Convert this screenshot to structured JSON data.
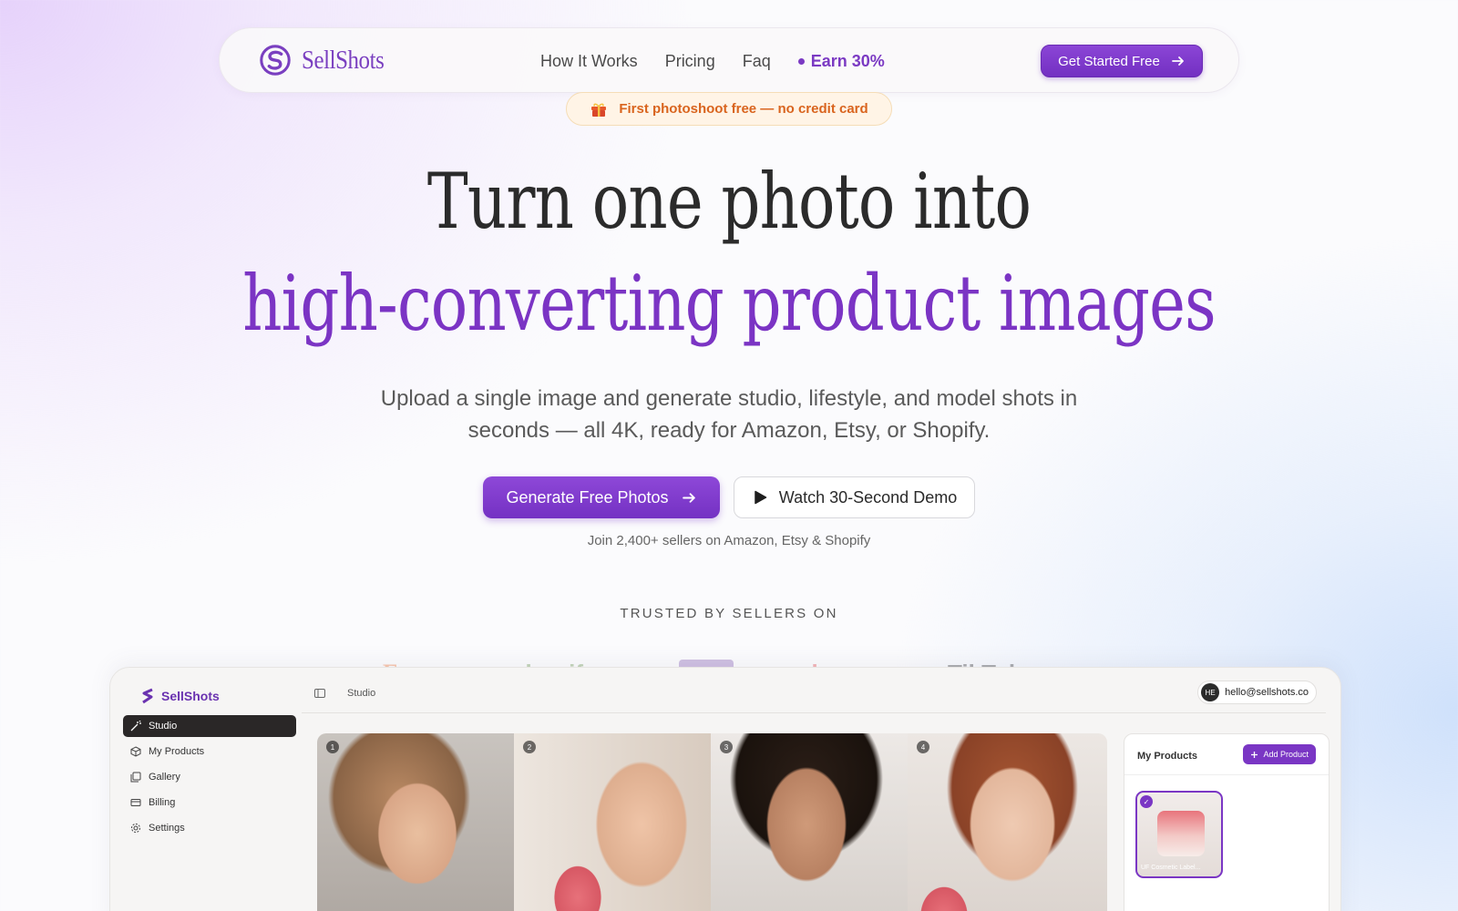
{
  "brand": {
    "name": "SellShots",
    "accent": "#7b34c4",
    "logo_icon": "sellshots-logo-icon"
  },
  "nav": {
    "links": [
      "How It Works",
      "Pricing",
      "Faq"
    ],
    "earn": "Earn 30%",
    "cta": "Get Started Free"
  },
  "promo": {
    "icon": "gift-icon",
    "text": "First photoshoot free — no credit card"
  },
  "hero": {
    "line1": "Turn one photo into",
    "line2": "high-converting product images",
    "subtitle": "Upload a single image and generate studio, lifestyle, and model shots in seconds — all 4K, ready for Amazon, Etsy, or Shopify.",
    "primary_cta": "Generate Free Photos",
    "secondary_cta": "Watch 30-Second Demo",
    "social_proof": "Join 2,400+ sellers on Amazon, Etsy & Shopify"
  },
  "trusted": {
    "heading": "TRUSTED BY SELLERS ON",
    "logos": [
      "amazon",
      "Etsy",
      "shopify",
      "woo",
      "ebay",
      "TikTok"
    ]
  },
  "app": {
    "brand": "SellShots",
    "sidebar": [
      {
        "label": "Studio",
        "icon": "wand-icon",
        "active": true
      },
      {
        "label": "My Products",
        "icon": "box-icon",
        "active": false
      },
      {
        "label": "Gallery",
        "icon": "gallery-icon",
        "active": false
      },
      {
        "label": "Billing",
        "icon": "card-icon",
        "active": false
      },
      {
        "label": "Settings",
        "icon": "gear-icon",
        "active": false
      }
    ],
    "breadcrumb": "Studio",
    "user": {
      "initials": "HE",
      "email": "hello@sellshots.co"
    },
    "shots": [
      "1",
      "2",
      "3",
      "4"
    ],
    "products_panel": {
      "title": "My Products",
      "add_label": "Add Product",
      "product_label": "UF Cosmetic Label..."
    }
  }
}
